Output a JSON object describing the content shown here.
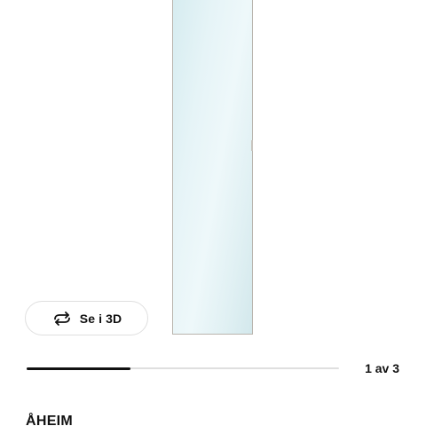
{
  "gallery": {
    "view3d_label": "Se i 3D",
    "view3d_icon": "rotate-3d-icon",
    "pager": "1 av 3",
    "progress_fraction": 0.333
  },
  "product": {
    "name": "ÅHEIM"
  },
  "colors": {
    "text": "#111111",
    "track": "#dfdfdf",
    "progress": "#111111",
    "mirror": "#e6f4f7"
  }
}
